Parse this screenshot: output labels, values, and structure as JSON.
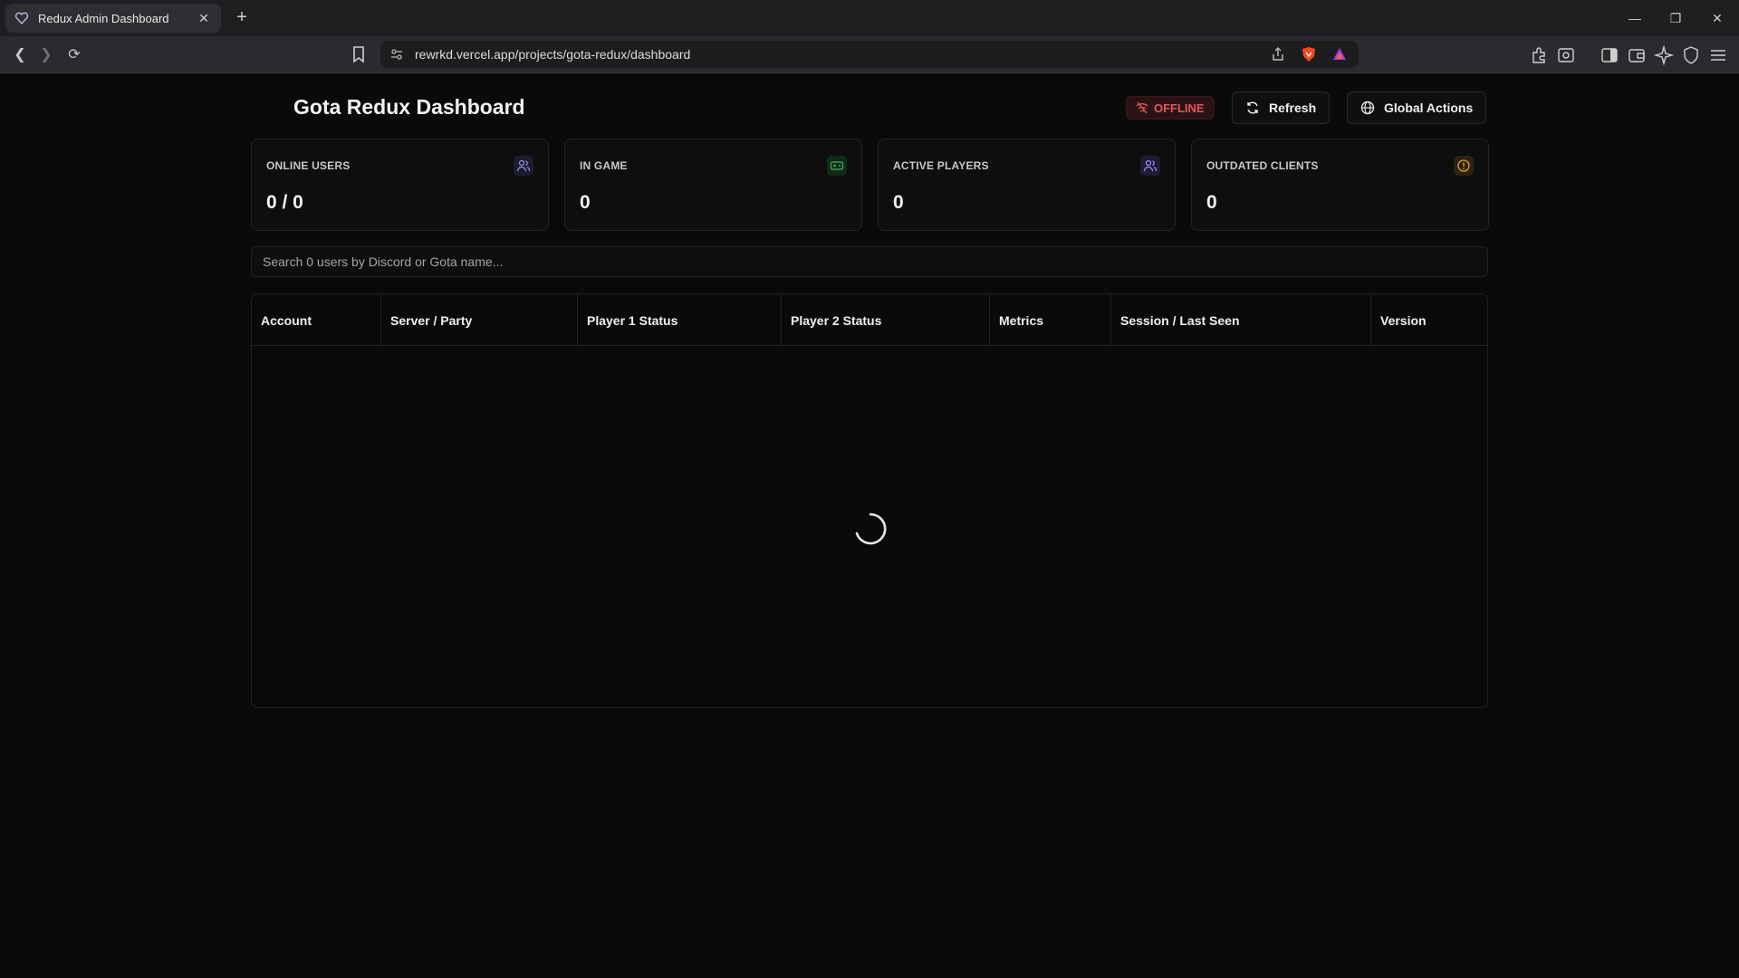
{
  "browser": {
    "tab_title": "Redux Admin Dashboard",
    "url": "rewrkd.vercel.app/projects/gota-redux/dashboard"
  },
  "header": {
    "title": "Gota Redux Dashboard",
    "status_badge": "OFFLINE",
    "refresh_label": "Refresh",
    "global_actions_label": "Global Actions"
  },
  "stats": [
    {
      "label": "ONLINE USERS",
      "value": "0 / 0",
      "icon": "users-icon"
    },
    {
      "label": "IN GAME",
      "value": "0",
      "icon": "gamepad-icon"
    },
    {
      "label": "ACTIVE PLAYERS",
      "value": "0",
      "icon": "users-icon"
    },
    {
      "label": "OUTDATED CLIENTS",
      "value": "0",
      "icon": "alert-circle-icon"
    }
  ],
  "search": {
    "placeholder": "Search 0 users by Discord or Gota name..."
  },
  "table": {
    "columns": [
      "Account",
      "Server / Party",
      "Player 1 Status",
      "Player 2 Status",
      "Metrics",
      "Session / Last Seen",
      "Version"
    ]
  },
  "colors": {
    "offline": "#e0565b",
    "accent_green": "#3fae5a",
    "accent_purple": "#7b6cf0",
    "accent_amber": "#e0a030"
  }
}
